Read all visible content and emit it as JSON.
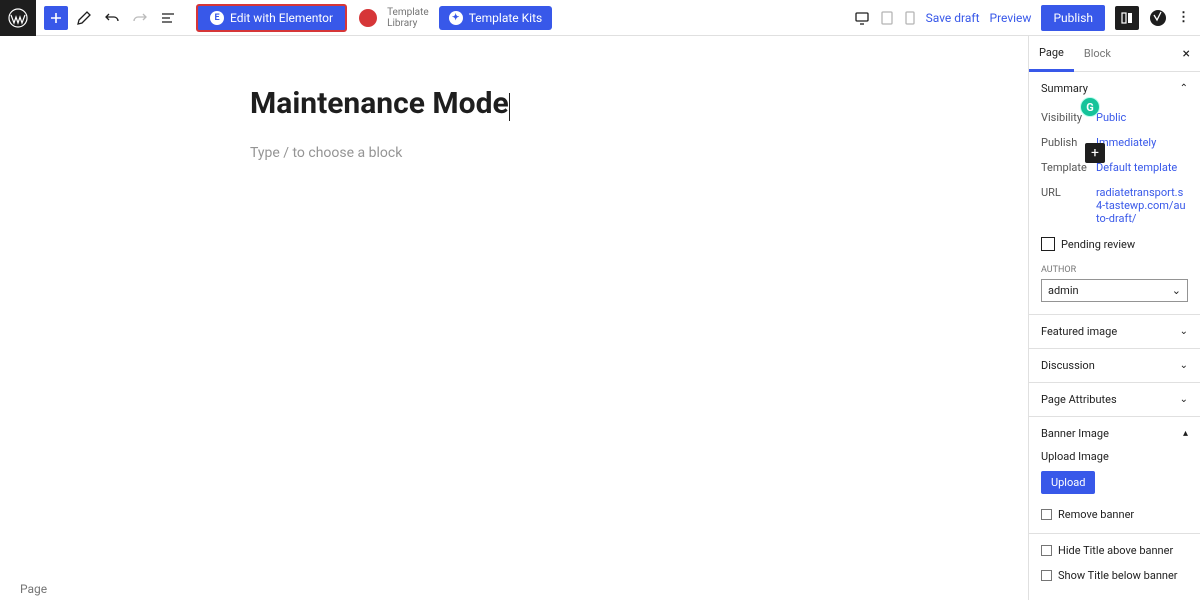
{
  "toolbar": {
    "edit_elementor": "Edit with Elementor",
    "template_library_l1": "Template",
    "template_library_l2": "Library",
    "template_kits": "Template Kits",
    "save_draft": "Save draft",
    "preview": "Preview",
    "publish": "Publish"
  },
  "editor": {
    "title": "Maintenance Mode",
    "block_placeholder": "Type / to choose a block",
    "breadcrumb": "Page"
  },
  "sidebar": {
    "tabs": {
      "page": "Page",
      "block": "Block"
    },
    "summary": {
      "label": "Summary",
      "visibility_label": "Visibility",
      "visibility_value": "Public",
      "publish_label": "Publish",
      "publish_value": "Immediately",
      "template_label": "Template",
      "template_value": "Default template",
      "url_label": "URL",
      "url_value": "radiatetransport.s4-tastewp.com/auto-draft/",
      "pending_review": "Pending review",
      "author_heading": "AUTHOR",
      "author_value": "admin"
    },
    "featured_image": "Featured image",
    "discussion": "Discussion",
    "page_attributes": "Page Attributes",
    "banner": {
      "label": "Banner Image",
      "upload_label": "Upload Image",
      "upload_btn": "Upload",
      "remove": "Remove banner",
      "hide_title_above": "Hide Title above banner",
      "show_title_below": "Show Title below banner"
    }
  }
}
